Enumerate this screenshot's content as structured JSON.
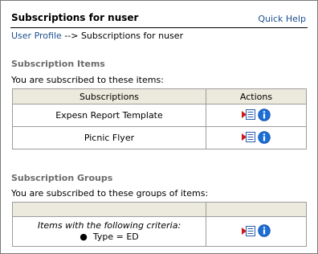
{
  "header": {
    "title": "Subscriptions for nuser",
    "quick_help": "Quick Help"
  },
  "breadcrumb": {
    "link": "User Profile",
    "separator": " --> ",
    "current": "Subscriptions for nuser"
  },
  "items_section": {
    "title": "Subscription Items",
    "description": "You are subscribed to these items:",
    "columns": [
      "Subscriptions",
      "Actions"
    ],
    "rows": [
      {
        "name": "Expesn Report Template"
      },
      {
        "name": "Picnic Flyer"
      }
    ]
  },
  "groups_section": {
    "title": "Subscription Groups",
    "description": "You are subscribed to these groups of items:",
    "rows": [
      {
        "criteria_heading": "Items with the following criteria:",
        "criteria": "Type = ED"
      }
    ]
  },
  "icons": {
    "list": "list-details-icon",
    "info": "info-icon"
  },
  "colors": {
    "link": "#1a4f91",
    "header_fill": "#eceadc",
    "section_title": "#6b6b6b",
    "info_blue": "#1c6fd8",
    "list_red": "#d01818"
  }
}
